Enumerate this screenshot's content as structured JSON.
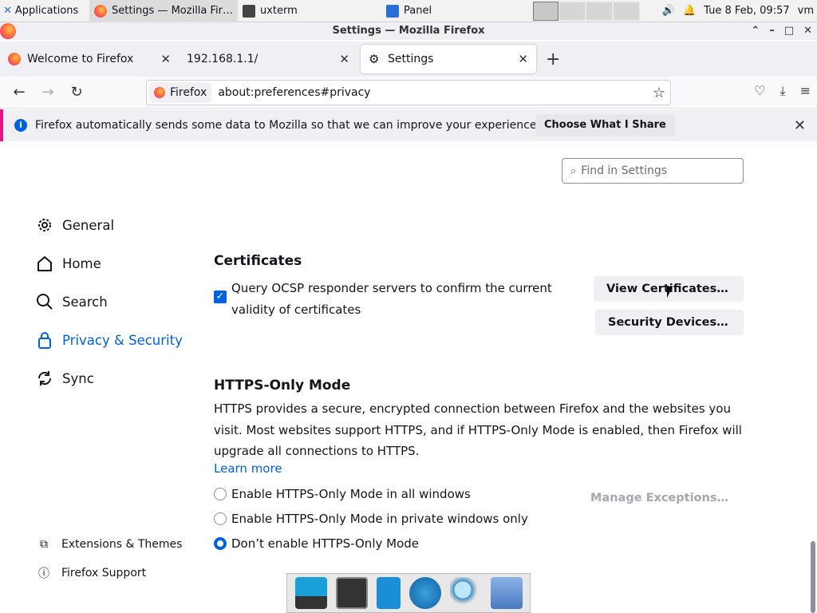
{
  "xpanel": {
    "apps": "Applications",
    "tasks": [
      {
        "label": "Settings — Mozilla Fir…"
      },
      {
        "label": "uxterm"
      },
      {
        "label": "Panel"
      }
    ],
    "datetime": "Tue  8 Feb, 09:57",
    "user": "vm"
  },
  "window": {
    "title": "Settings — Mozilla Firefox"
  },
  "tabs": [
    {
      "label": "Welcome to Firefox"
    },
    {
      "label": "192.168.1.1/"
    },
    {
      "label": "Settings"
    }
  ],
  "urlbar": {
    "identity": "Firefox",
    "url": "about:preferences#privacy"
  },
  "notification": {
    "text": "Firefox automatically sends some data to Mozilla so that we can improve your experience.",
    "button": "Choose What I Share"
  },
  "search": {
    "placeholder": "Find in Settings"
  },
  "categories": [
    {
      "label": "General"
    },
    {
      "label": "Home"
    },
    {
      "label": "Search"
    },
    {
      "label": "Privacy & Security"
    },
    {
      "label": "Sync"
    }
  ],
  "bottom_links": [
    {
      "label": "Extensions & Themes"
    },
    {
      "label": "Firefox Support"
    }
  ],
  "certificates": {
    "heading": "Certificates",
    "ocsp_label": "Query OCSP responder servers to confirm the current validity of certificates",
    "ocsp_checked": true,
    "view_button": "View Certificates…",
    "devices_button": "Security Devices…"
  },
  "https_only": {
    "heading": "HTTPS-Only Mode",
    "description": "HTTPS provides a secure, encrypted connection between Firefox and the websites you visit. Most websites support HTTPS, and if HTTPS-Only Mode is enabled, then Firefox will upgrade all connections to HTTPS.",
    "learn_more": "Learn more",
    "options": [
      {
        "label": "Enable HTTPS-Only Mode in all windows",
        "selected": false
      },
      {
        "label": "Enable HTTPS-Only Mode in private windows only",
        "selected": false
      },
      {
        "label": "Don’t enable HTTPS-Only Mode",
        "selected": true
      }
    ],
    "exceptions_button": "Manage Exceptions…"
  },
  "colors": {
    "accent": "#0061e0",
    "notif_border": "#e31587"
  }
}
